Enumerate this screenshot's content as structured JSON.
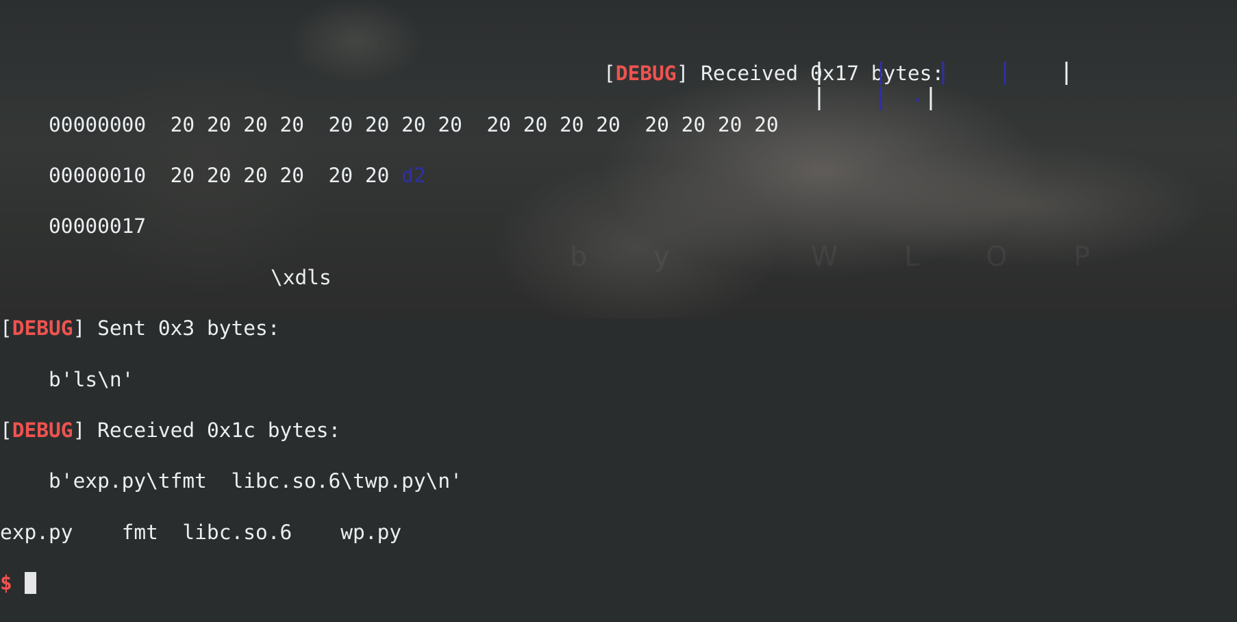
{
  "terminal": {
    "recv1": {
      "bracket_open": "[",
      "tag": "DEBUG",
      "bracket_close": "]",
      "message": " Received 0x17 bytes:"
    },
    "hexdump": [
      {
        "offset": "00000000",
        "bytes": "20 20 20 20  20 20 20 20  20 20 20 20  20 20 20 20",
        "extra": ""
      },
      {
        "offset": "00000010",
        "bytes": "20 20 20 20  20 20",
        "extra": "d2"
      },
      {
        "offset": "00000017",
        "bytes": "",
        "extra": ""
      }
    ],
    "xdls_line": "\\xdls",
    "sent": {
      "bracket_open": "[",
      "tag": "DEBUG",
      "bracket_close": "]",
      "message": " Sent 0x3 bytes:",
      "payload": "b'ls\\n'"
    },
    "recv2": {
      "bracket_open": "[",
      "tag": "DEBUG",
      "bracket_close": "]",
      "message": " Received 0x1c bytes:",
      "payload": "b'exp.py\\tfmt  libc.so.6\\twp.py\\n'"
    },
    "ls_output": "exp.py    fmt  libc.so.6    wp.py",
    "prompt": "$",
    "watermark": "b y   W L O P",
    "colors": {
      "foreground": "#eceff1",
      "debug_tag": "#ef5350",
      "hex_highlight": "#2f2fa8",
      "cursor": "#e6e6e6"
    }
  }
}
